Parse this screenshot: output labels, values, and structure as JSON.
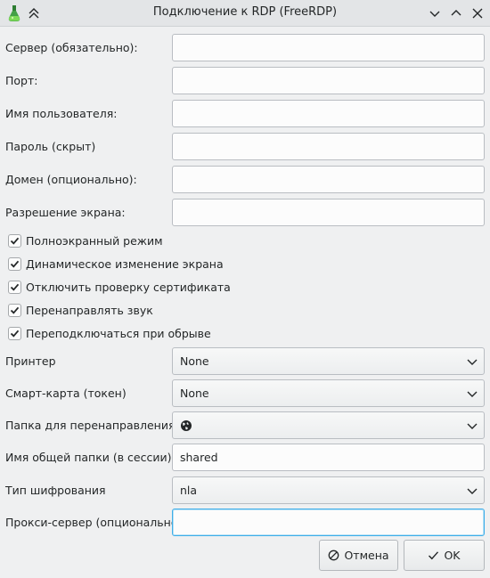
{
  "window": {
    "title": "Подключение к RDP (FreeRDP)"
  },
  "labels": {
    "server": "Сервер (обязательно):",
    "port": "Порт:",
    "username": "Имя пользователя:",
    "password": "Пароль (скрыт)",
    "domain": "Домен (опционально):",
    "resolution": "Разрешение экрана:",
    "printer": "Принтер",
    "smartcard": "Смарт-карта (токен)",
    "redirect_folder": "Папка для перенаправления",
    "share_name": "Имя общей папки (в сессии):",
    "encryption": "Тип шифрования",
    "proxy": "Прокси-сервер (опционально):"
  },
  "fields": {
    "server": "",
    "port": "",
    "username": "",
    "password": "",
    "domain": "",
    "resolution": "",
    "share_name": "shared",
    "proxy": ""
  },
  "checkboxes": [
    {
      "label": "Полноэкранный режим",
      "checked": true
    },
    {
      "label": "Динамическое изменение экрана",
      "checked": true
    },
    {
      "label": "Отключить проверку сертификата",
      "checked": true
    },
    {
      "label": "Перенаправлять звук",
      "checked": true
    },
    {
      "label": "Переподключаться при обрыве",
      "checked": true
    }
  ],
  "combos": {
    "printer": "None",
    "smartcard": "None",
    "redirect_folder": "",
    "encryption": "nla"
  },
  "buttons": {
    "cancel": "Отмена",
    "ok": "OK"
  },
  "icons": {
    "app": "flask-icon",
    "keep_above": "keep-above-icon",
    "minimize": "chevron-down-icon",
    "maximize": "chevron-up-icon",
    "close": "close-icon",
    "folder_network": "globe-icon",
    "cancel": "cancel-icon",
    "ok": "checkmark-icon"
  },
  "colors": {
    "accent": "#3daee9",
    "background": "#eff0f1"
  }
}
